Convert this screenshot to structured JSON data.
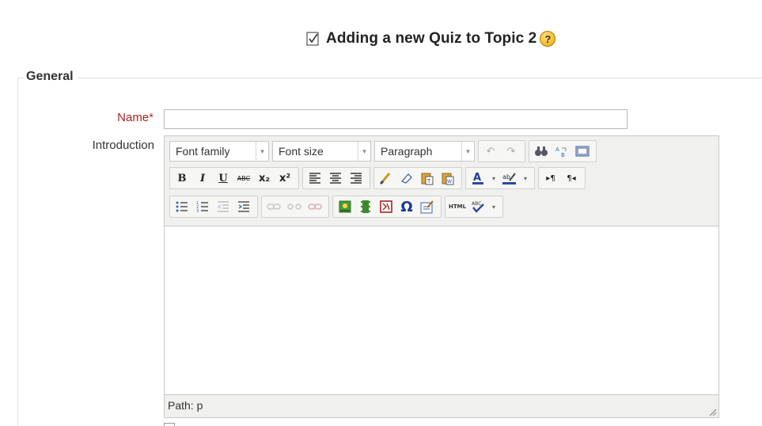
{
  "header": {
    "title": "Adding a new Quiz to Topic 2",
    "quiz_icon": "quiz-icon",
    "help_icon": "?"
  },
  "fieldset": {
    "legend": "General"
  },
  "form": {
    "name_label": "Name",
    "name_required_marker": "*",
    "name_value": "",
    "intro_label": "Introduction"
  },
  "editor": {
    "font_family": "Font family",
    "font_size": "Font size",
    "format": "Paragraph",
    "path_label": "Path: p",
    "content": "",
    "icons": {
      "bold": "B",
      "italic": "I",
      "underline": "U",
      "strikethrough": "ABC",
      "subscript": "x₂",
      "superscript": "x²",
      "special_char": "Ω",
      "html": "HTML"
    }
  },
  "colors": {
    "required": "#cc2222",
    "label": "#333333",
    "toolbar_bg": "#f0f0ee"
  }
}
